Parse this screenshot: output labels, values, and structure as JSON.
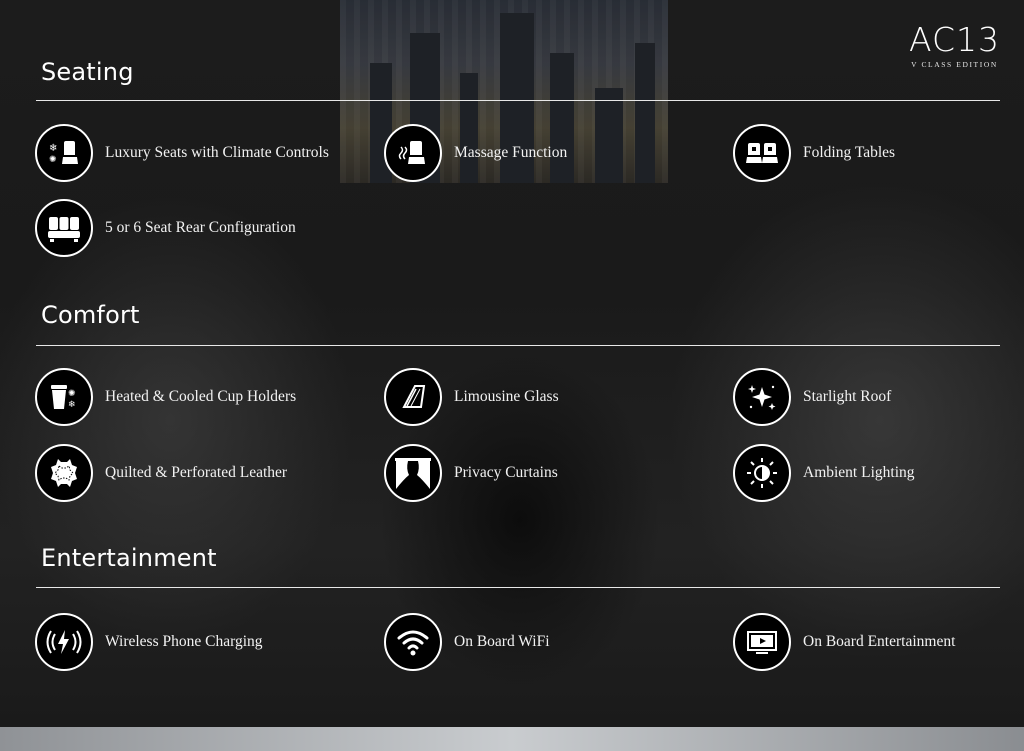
{
  "logo": {
    "main": "AC13",
    "sub": "V CLASS EDITION"
  },
  "sections": [
    {
      "title": "Seating",
      "features": [
        {
          "label": "Luxury Seats with Climate Controls",
          "icon": "climate-seat-icon"
        },
        {
          "label": "Massage Function",
          "icon": "massage-seat-icon"
        },
        {
          "label": "Folding Tables",
          "icon": "folding-table-seats-icon"
        },
        {
          "label": "5 or 6 Seat Rear Configuration",
          "icon": "seat-configuration-icon"
        }
      ]
    },
    {
      "title": "Comfort",
      "features": [
        {
          "label": "Heated & Cooled Cup Holders",
          "icon": "cup-holder-icon"
        },
        {
          "label": "Limousine Glass",
          "icon": "tinted-glass-icon"
        },
        {
          "label": "Starlight Roof",
          "icon": "sparkle-stars-icon"
        },
        {
          "label": "Quilted & Perforated Leather",
          "icon": "leather-hide-icon"
        },
        {
          "label": "Privacy Curtains",
          "icon": "curtains-icon"
        },
        {
          "label": "Ambient Lighting",
          "icon": "ambient-light-icon"
        }
      ]
    },
    {
      "title": "Entertainment",
      "features": [
        {
          "label": "Wireless Phone Charging",
          "icon": "wireless-charging-icon"
        },
        {
          "label": "On Board WiFi",
          "icon": "wifi-icon"
        },
        {
          "label": "On Board Entertainment",
          "icon": "screen-play-icon"
        }
      ]
    }
  ],
  "colors": {
    "background": "#141414",
    "text": "#ffffff",
    "rule": "#e8e8e8",
    "icon_bg": "#000000"
  }
}
